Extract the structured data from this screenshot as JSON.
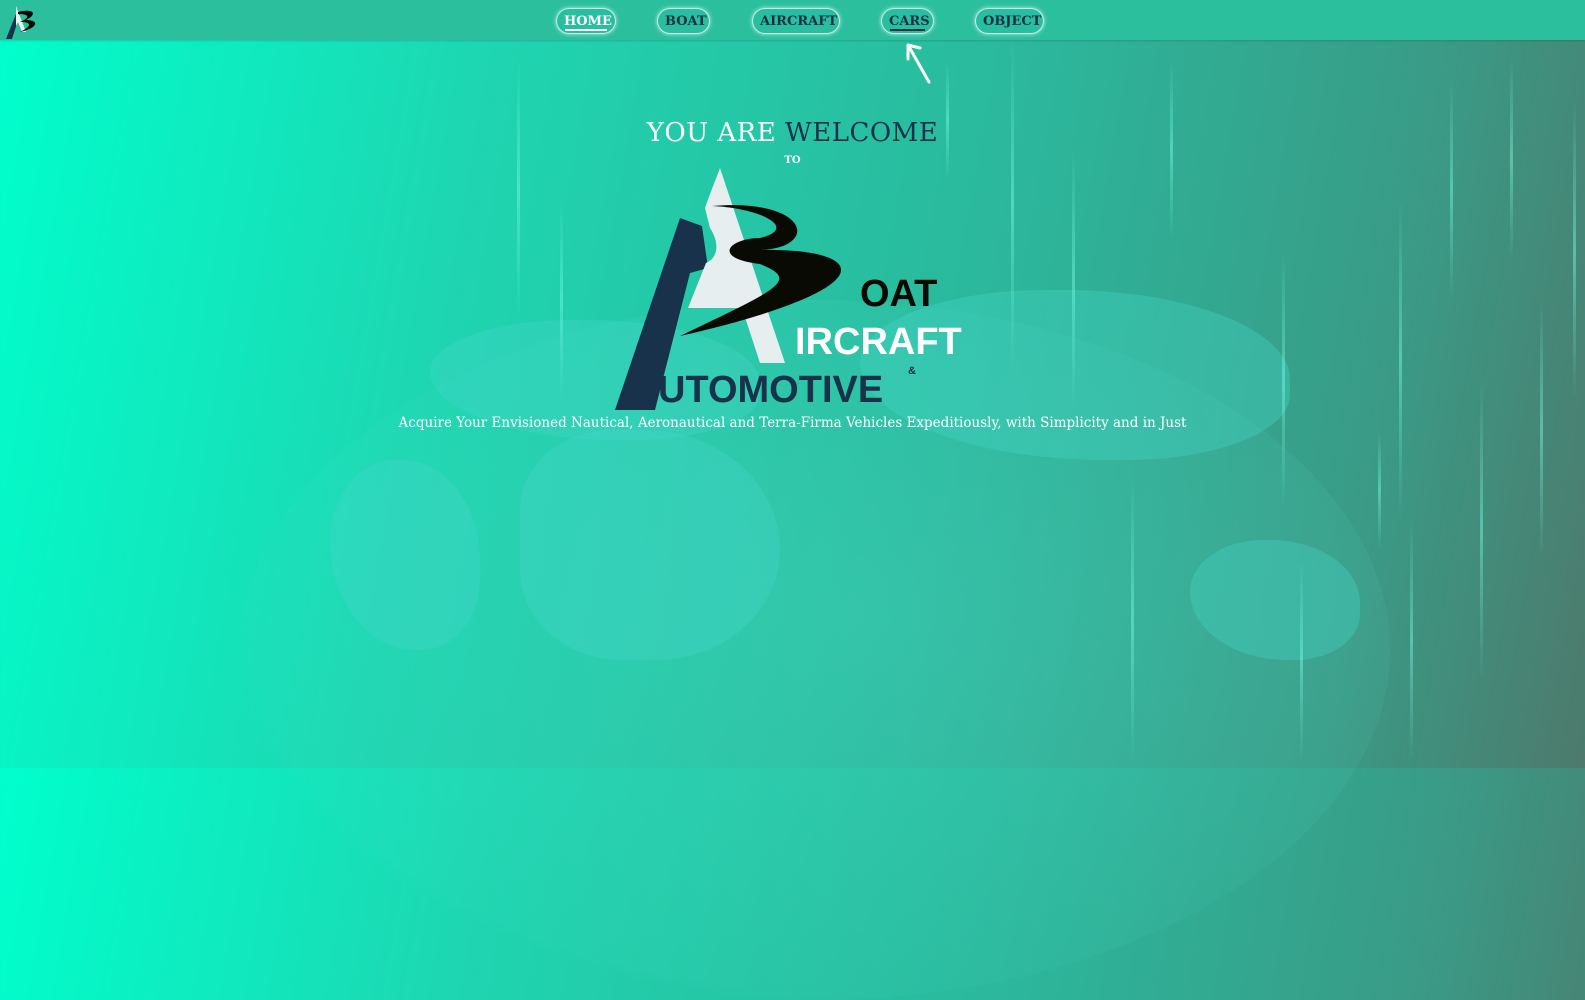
{
  "nav": {
    "items": [
      {
        "label": "HOME",
        "state": "active"
      },
      {
        "label": "BOAT",
        "state": "normal"
      },
      {
        "label": "AIRCRAFT",
        "state": "normal"
      },
      {
        "label": "CARS",
        "state": "hovered"
      },
      {
        "label": "OBJECT",
        "state": "normal"
      }
    ]
  },
  "hero": {
    "welcome_part1": "YOU ARE",
    "welcome_part2": "WELCOME",
    "to": "TO",
    "logo_words": {
      "boat": "OAT",
      "aircraft": "IRCRAFT",
      "automotive": "UTOMOTIVE",
      "ampersand": "&"
    },
    "tagline": "Acquire Your Envisioned Nautical, Aeronautical and Terra-Firma Vehicles Expeditiously, with Simplicity and in Just"
  },
  "icons": {
    "site_logo": "abc-monogram-icon",
    "cursor": "mouse-pointer-icon"
  },
  "colors": {
    "navy": "#17324a",
    "teal_bar": "#2cbf9e",
    "aqua": "#00ffcc",
    "white": "#ffffff",
    "black": "#0a0a05"
  }
}
